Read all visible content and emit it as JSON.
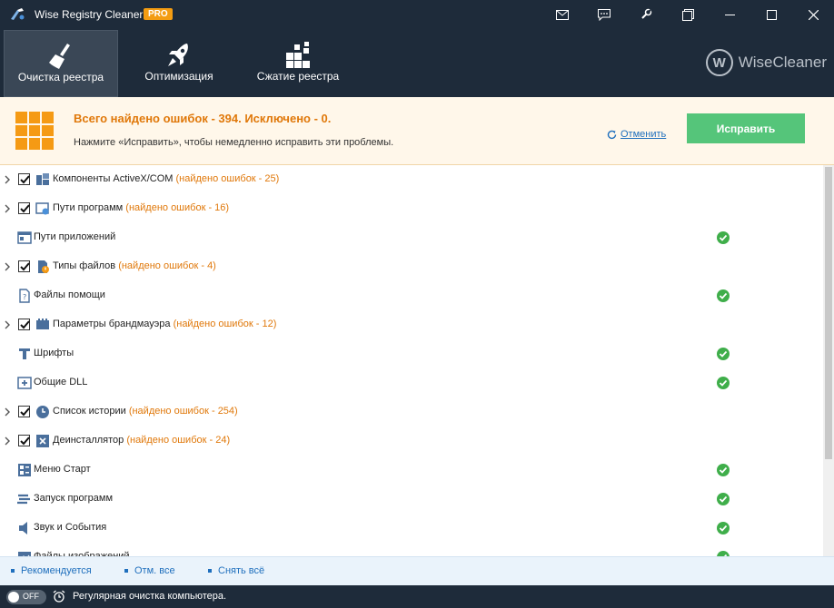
{
  "app": {
    "title": "Wise Registry Cleaner X",
    "badge": "PRO",
    "brand": "WiseCleaner",
    "brand_letter": "W"
  },
  "titlebar_buttons": [
    "mail-icon",
    "feedback-icon",
    "settings-icon",
    "restore-icon",
    "minimize-icon",
    "maximize-icon",
    "close-icon"
  ],
  "tabs": [
    {
      "label": "Очистка реестра",
      "icon": "broom-icon",
      "active": true
    },
    {
      "label": "Оптимизация",
      "icon": "rocket-icon",
      "active": false
    },
    {
      "label": "Сжатие реестра",
      "icon": "blocks-icon",
      "active": false
    }
  ],
  "banner": {
    "title": "Всего найдено ошибок - 394. Исключено - 0.",
    "subtitle": "Нажмите «Исправить», чтобы немедленно исправить эти проблемы.",
    "cancel_label": "Отменить",
    "fix_label": "Исправить"
  },
  "items": [
    {
      "label": "Компоненты ActiveX/COM",
      "count": "(найдено ошибок - 25)",
      "icon": "component-icon",
      "expandable": true,
      "checked": true,
      "ok": false
    },
    {
      "label": "Пути программ",
      "count": "(найдено ошибок - 16)",
      "icon": "program-path-icon",
      "expandable": true,
      "checked": true,
      "ok": false
    },
    {
      "label": "Пути приложений",
      "count": "",
      "icon": "app-window-icon",
      "expandable": false,
      "checked": false,
      "ok": true
    },
    {
      "label": "Типы файлов",
      "count": "(найдено ошибок - 4)",
      "icon": "file-type-icon",
      "expandable": true,
      "checked": true,
      "ok": false
    },
    {
      "label": "Файлы помощи",
      "count": "",
      "icon": "help-file-icon",
      "expandable": false,
      "checked": false,
      "ok": true
    },
    {
      "label": "Параметры брандмауэра",
      "count": "(найдено ошибок - 12)",
      "icon": "firewall-icon",
      "expandable": true,
      "checked": true,
      "ok": false
    },
    {
      "label": "Шрифты",
      "count": "",
      "icon": "font-icon",
      "expandable": false,
      "checked": false,
      "ok": true
    },
    {
      "label": "Общие DLL",
      "count": "",
      "icon": "dll-icon",
      "expandable": false,
      "checked": false,
      "ok": true
    },
    {
      "label": "Список истории",
      "count": "(найдено ошибок - 254)",
      "icon": "history-clock-icon",
      "expandable": true,
      "checked": true,
      "ok": false
    },
    {
      "label": "Деинсталлятор",
      "count": "(найдено ошибок - 24)",
      "icon": "uninstall-icon",
      "expandable": true,
      "checked": true,
      "ok": false
    },
    {
      "label": "Меню Старт",
      "count": "",
      "icon": "start-menu-icon",
      "expandable": false,
      "checked": false,
      "ok": true
    },
    {
      "label": "Запуск программ",
      "count": "",
      "icon": "startup-icon",
      "expandable": false,
      "checked": false,
      "ok": true
    },
    {
      "label": "Звук и События",
      "count": "",
      "icon": "sound-icon",
      "expandable": false,
      "checked": false,
      "ok": true
    },
    {
      "label": "Файлы изображений",
      "count": "",
      "icon": "image-file-icon",
      "expandable": false,
      "checked": false,
      "ok": true
    }
  ],
  "bottom_links": {
    "recommended": "Рекомендуется",
    "select_all": "Отм. все",
    "deselect_all": "Снять всё"
  },
  "status": {
    "toggle_state": "OFF",
    "text": "Регулярная очистка компьютера."
  },
  "colors": {
    "header_bg": "#1e2b3a",
    "accent_orange": "#e0780a",
    "fix_green": "#55c57a",
    "ok_green": "#3fae4a",
    "link_blue": "#1f6fbd"
  }
}
